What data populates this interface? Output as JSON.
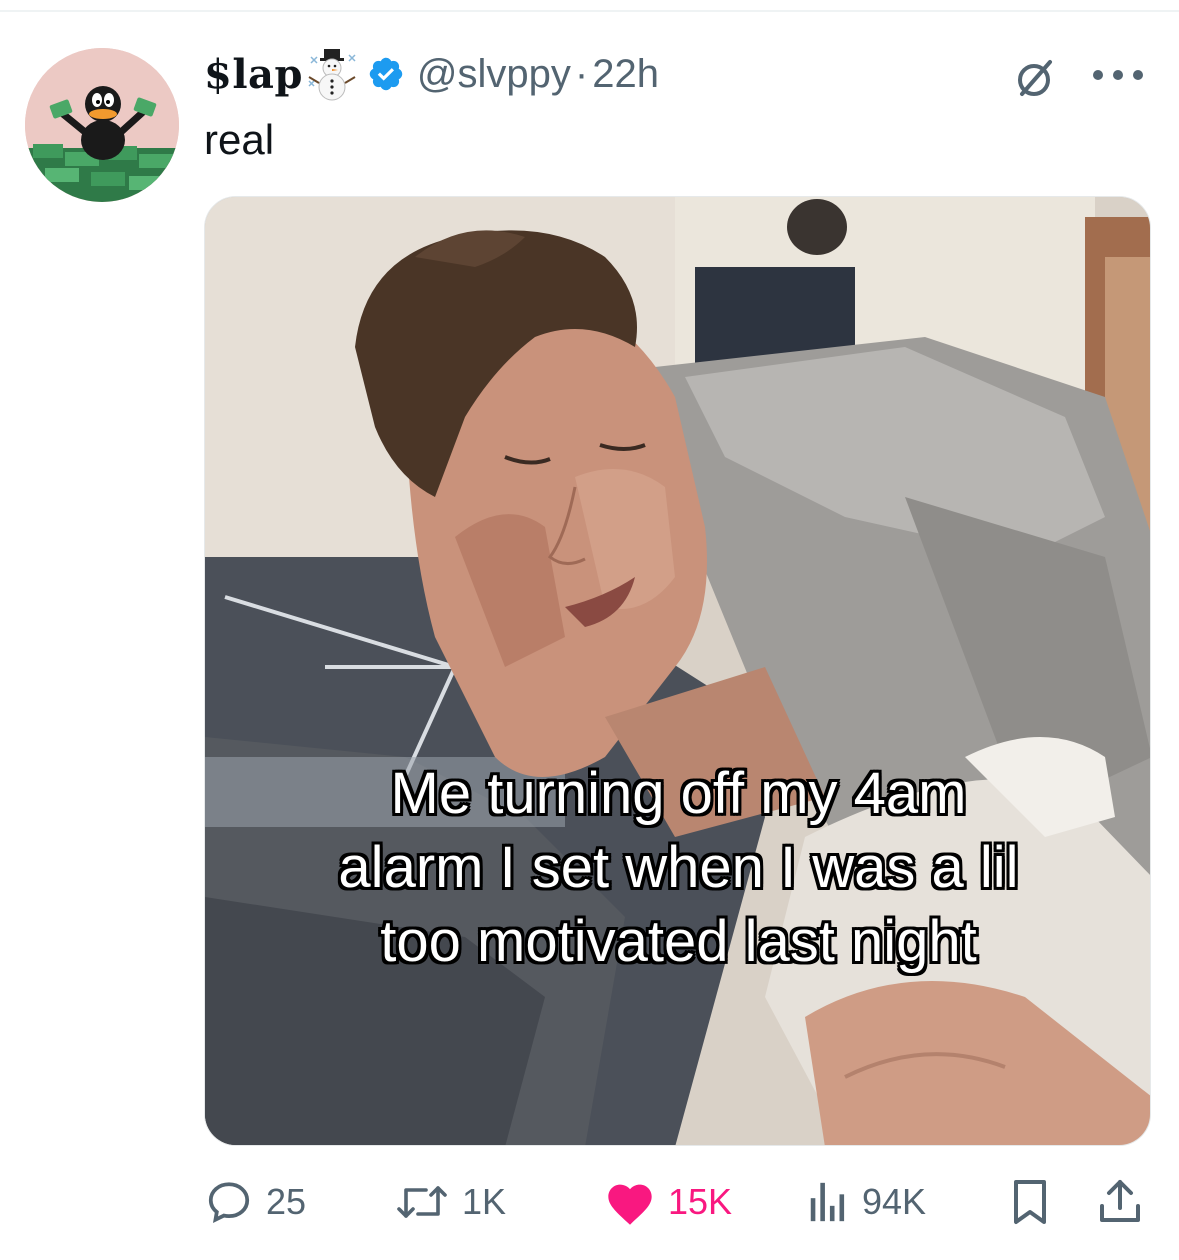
{
  "post": {
    "display_name": "$lap",
    "display_name_emoji_icon": "snowman-icon",
    "verified_icon": "verified-badge-icon",
    "handle": "@slvppy",
    "separator": "·",
    "timestamp": "22h",
    "text": "real",
    "media": {
      "caption_lines": [
        "Me turning off my 4am",
        "alarm I set when I was a lil",
        "too motivated last night"
      ]
    }
  },
  "header_actions": {
    "grok_icon": "grok-icon",
    "more_icon": "more-icon"
  },
  "actions": {
    "reply_count": "25",
    "repost_count": "1K",
    "like_count": "15K",
    "view_count": "94K",
    "liked": true
  },
  "colors": {
    "verified": "#1d9bf0",
    "like": "#f91880",
    "secondary_text": "#536471",
    "primary_text": "#0f1419"
  }
}
